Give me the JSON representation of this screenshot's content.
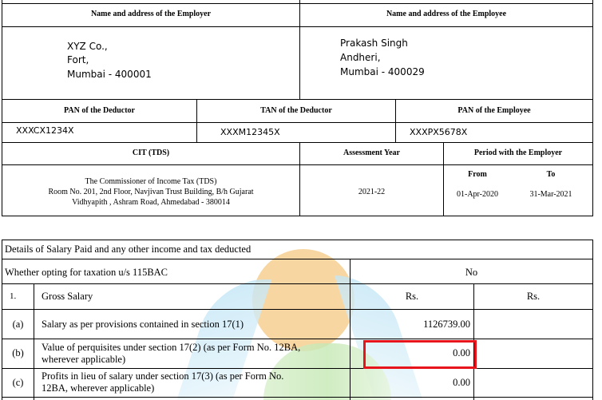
{
  "employer_header": "Name and address of the Employer",
  "employee_header": "Name and address of the Employee",
  "employer_address": [
    "XYZ Co.,",
    "Fort,",
    "Mumbai - 400001"
  ],
  "employee_address": [
    "Prakash Singh",
    "Andheri,",
    "Mumbai - 400029"
  ],
  "pan_deductor_label": "PAN of the Deductor",
  "tan_deductor_label": "TAN of the Deductor",
  "pan_employee_label": "PAN of the Employee",
  "pan_deductor": "XXXCX1234X",
  "tan_deductor": "XXXM12345X",
  "pan_employee": "XXXPX5678X",
  "cit_label": "CIT (TDS)",
  "assessment_year_label": "Assessment Year",
  "period_label": "Period with the Employer",
  "cit_address": [
    "The Commissioner of Income Tax (TDS)",
    "Room No. 201, 2nd Floor, Navjivan Trust Building, B/h Gujarat",
    "Vidhyapith , Ashram Road, Ahmedabad - 380014"
  ],
  "assessment_year": "2021-22",
  "from_label": "From",
  "to_label": "To",
  "period_from": "01-Apr-2020",
  "period_to": "31-Mar-2021",
  "details_title": "Details of Salary Paid and any other income and tax deducted",
  "taxation_question": "Whether opting for taxation u/s 115BAC",
  "taxation_answer": "No",
  "gross_salary": {
    "num": "1.",
    "label": "Gross Salary",
    "col1": "Rs.",
    "col2": "Rs."
  },
  "rows": [
    {
      "id": "(a)",
      "desc": [
        "Salary as per provisions contained in section 17(1)"
      ],
      "amount": "1126739.00"
    },
    {
      "id": "(b)",
      "desc": [
        "Value of perquisites under section 17(2) (as per Form No. 12BA,",
        "wherever applicable)"
      ],
      "amount": "0.00"
    },
    {
      "id": "(c)",
      "desc": [
        "Profits in lieu of salary under section 17(3) (as per Form No.",
        "12BA, wherever applicable)"
      ],
      "amount": "0.00"
    }
  ],
  "colors": {
    "highlight": "#e8141c",
    "watermark_orange": "#f5c27d",
    "watermark_blue": "#8fd0ee",
    "watermark_green": "#b9e3a5"
  }
}
